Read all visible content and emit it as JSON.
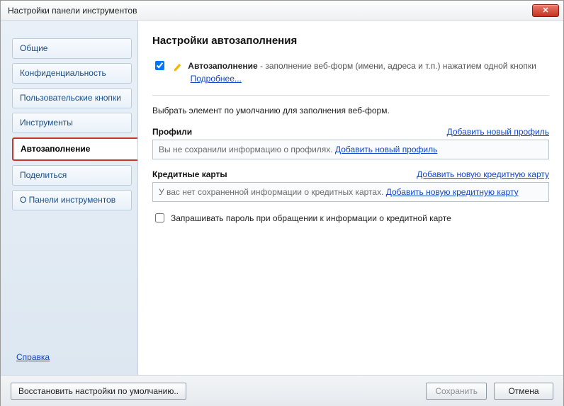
{
  "window": {
    "title": "Настройки панели инструментов"
  },
  "sidebar": {
    "items": [
      {
        "label": "Общие"
      },
      {
        "label": "Конфиденциальность"
      },
      {
        "label": "Пользовательские кнопки"
      },
      {
        "label": "Инструменты"
      },
      {
        "label": "Автозаполнение"
      },
      {
        "label": "Поделиться"
      },
      {
        "label": "О Панели инструментов"
      }
    ],
    "help_label": "Справка"
  },
  "main": {
    "title": "Настройки автозаполнения",
    "autofill": {
      "checked": true,
      "name": "Автозаполнение",
      "description": " - заполнение веб-форм (имени, адреса и т.п.) нажатием одной кнопки",
      "more_link": "Подробнее..."
    },
    "default_prompt": "Выбрать элемент по умолчанию для заполнения веб-форм.",
    "profiles": {
      "label": "Профили",
      "add_link": "Добавить новый профиль",
      "empty_text": "Вы не сохранили информацию о профилях. ",
      "empty_link": "Добавить новый профиль"
    },
    "cards": {
      "label": "Кредитные карты",
      "add_link": "Добавить новую кредитную карту",
      "empty_text": "У вас нет сохраненной информации о кредитных картах. ",
      "empty_link": "Добавить новую кредитную карту",
      "ask_password_label": "Запрашивать пароль при обращении к информации о кредитной карте"
    }
  },
  "footer": {
    "restore": "Восстановить настройки по умолчанию..",
    "save": "Сохранить",
    "cancel": "Отмена"
  }
}
